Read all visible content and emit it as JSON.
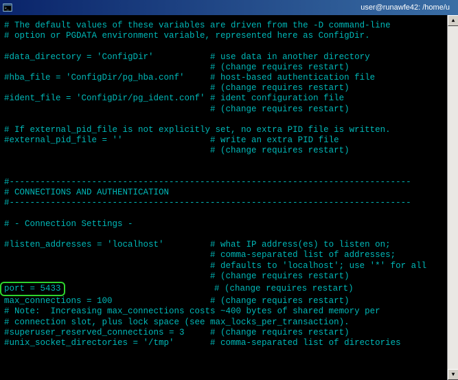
{
  "titlebar": {
    "path": "user@runawfe42: /home/u"
  },
  "terminal": {
    "block1_1": "# The default values of these variables are driven from the -D command-line",
    "block1_2": "# option or PGDATA environment variable, represented here as ConfigDir.",
    "data_dir": "#data_directory = 'ConfigDir'           # use data in another directory",
    "data_dir_c": "                                        # (change requires restart)",
    "hba": "#hba_file = 'ConfigDir/pg_hba.conf'     # host-based authentication file",
    "hba_c": "                                        # (change requires restart)",
    "ident": "#ident_file = 'ConfigDir/pg_ident.conf' # ident configuration file",
    "ident_c": "                                        # (change requires restart)",
    "ext1": "# If external_pid_file is not explicitly set, no extra PID file is written.",
    "ext2": "#external_pid_file = ''                 # write an extra PID file",
    "ext3": "                                        # (change requires restart)",
    "sep1": "#------------------------------------------------------------------------------",
    "sep_h": "# CONNECTIONS AND AUTHENTICATION",
    "sep2": "#------------------------------------------------------------------------------",
    "conn_h": "# - Connection Settings -",
    "listen1": "#listen_addresses = 'localhost'         # what IP address(es) to listen on;",
    "listen2": "                                        # comma-separated list of addresses;",
    "listen3": "                                        # defaults to 'localhost'; use '*' for all",
    "listen4": "                                        # (change requires restart)",
    "port_key": "port = 5433",
    "port_rest": "                             # (change requires restart)",
    "maxc": "max_connections = 100                   # (change requires restart)",
    "note1": "# Note:  Increasing max_connections costs ~400 bytes of shared memory per",
    "note2": "# connection slot, plus lock space (see max_locks_per_transaction).",
    "super": "#superuser_reserved_connections = 3     # (change requires restart)",
    "unix": "#unix_socket_directories = '/tmp'       # comma-separated list of directories"
  }
}
